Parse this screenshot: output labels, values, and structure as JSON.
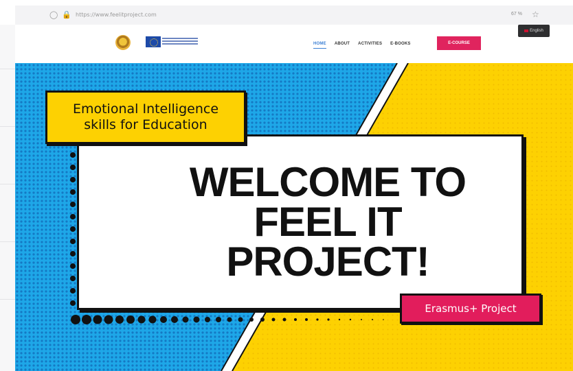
{
  "browser": {
    "url": "https://www.feelitproject.com",
    "zoom": "67 %"
  },
  "header": {
    "menu": [
      {
        "label": "HOME",
        "active": true
      },
      {
        "label": "ABOUT",
        "active": false
      },
      {
        "label": "ACTIVITIES",
        "active": false
      },
      {
        "label": "E-BOOKS",
        "active": false
      }
    ],
    "ebook_button": "E-COURSE",
    "language": "English"
  },
  "hero": {
    "tag_lines": [
      "Emotional Intelligence",
      "skills for Education"
    ],
    "welcome_lines": [
      "WELCOME TO",
      "FEEL IT",
      "PROJECT!"
    ],
    "badge": "Erasmus+ Project"
  },
  "colors": {
    "blue": "#1ea7e8",
    "yellow": "#fdd102",
    "pink": "#e21d5c",
    "dark": "#111111"
  }
}
